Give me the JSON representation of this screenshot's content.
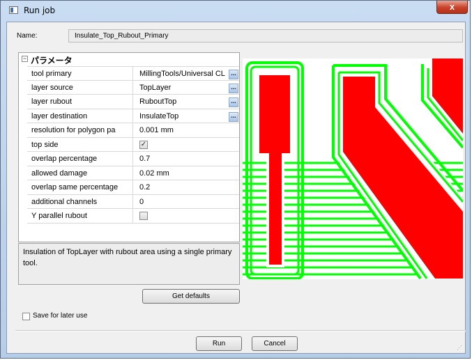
{
  "window": {
    "title": "Run job",
    "close_label": "x"
  },
  "name": {
    "label": "Name:",
    "value": "Insulate_Top_Rubout_Primary"
  },
  "properties": {
    "group_title": "パラメータ",
    "rows": [
      {
        "name": "tool primary",
        "value": "MillingTools/Universal CL",
        "has_browse": true
      },
      {
        "name": "layer source",
        "value": "TopLayer",
        "has_browse": true
      },
      {
        "name": "layer rubout",
        "value": "RuboutTop",
        "has_browse": true
      },
      {
        "name": "layer destination",
        "value": "InsulateTop",
        "has_browse": true
      },
      {
        "name": "resolution for polygon pa",
        "value": "0.001 mm"
      },
      {
        "name": "top side",
        "checkbox": true,
        "checked": true
      },
      {
        "name": "overlap percentage",
        "value": "0.7"
      },
      {
        "name": "allowed damage",
        "value": "0.02 mm"
      },
      {
        "name": "overlap same percentage",
        "value": "0.2"
      },
      {
        "name": "additional channels",
        "value": "0"
      },
      {
        "name": "Y parallel rubout",
        "checkbox": true,
        "checked": false
      }
    ],
    "browse_label": "..."
  },
  "description": "Insulation of TopLayer with rubout area using a single primary tool.",
  "buttons": {
    "get_defaults": "Get defaults",
    "run": "Run",
    "cancel": "Cancel"
  },
  "save_for_later": {
    "label": "Save for later use",
    "checked": false
  },
  "colors": {
    "copper": "#ff0000",
    "rubout": "#00ff00",
    "background": "#ffffff"
  }
}
